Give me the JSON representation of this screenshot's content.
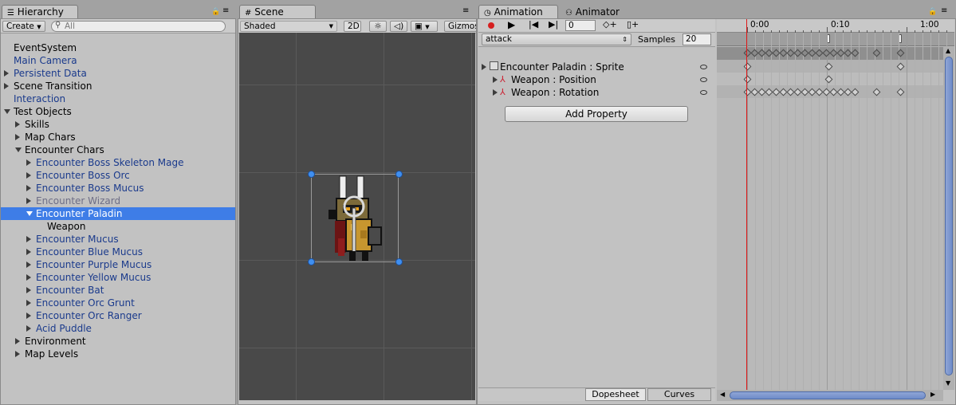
{
  "hierarchy": {
    "tab_label": "Hierarchy",
    "create_label": "Create",
    "search_placeholder": "All",
    "items": [
      {
        "label": "EventSystem",
        "depth": 0,
        "arrow": "none",
        "style": "normal"
      },
      {
        "label": "Main Camera",
        "depth": 0,
        "arrow": "none",
        "style": "blue"
      },
      {
        "label": "Persistent Data",
        "depth": 0,
        "arrow": "right",
        "style": "blue"
      },
      {
        "label": "Scene Transition",
        "depth": 0,
        "arrow": "right",
        "style": "normal"
      },
      {
        "label": "Interaction",
        "depth": 0,
        "arrow": "none",
        "style": "blue"
      },
      {
        "label": "Test Objects",
        "depth": 0,
        "arrow": "down",
        "style": "normal"
      },
      {
        "label": "Skills",
        "depth": 1,
        "arrow": "right",
        "style": "normal"
      },
      {
        "label": "Map Chars",
        "depth": 1,
        "arrow": "right",
        "style": "normal"
      },
      {
        "label": "Encounter Chars",
        "depth": 1,
        "arrow": "down",
        "style": "normal"
      },
      {
        "label": "Encounter Boss Skeleton Mage",
        "depth": 2,
        "arrow": "right",
        "style": "blue"
      },
      {
        "label": "Encounter Boss Orc",
        "depth": 2,
        "arrow": "right",
        "style": "blue"
      },
      {
        "label": "Encounter Boss Mucus",
        "depth": 2,
        "arrow": "right",
        "style": "blue"
      },
      {
        "label": "Encounter Wizard",
        "depth": 2,
        "arrow": "right",
        "style": "gray"
      },
      {
        "label": "Encounter Paladin",
        "depth": 2,
        "arrow": "down",
        "style": "selected"
      },
      {
        "label": "Weapon",
        "depth": 3,
        "arrow": "none",
        "style": "normal"
      },
      {
        "label": "Encounter Mucus",
        "depth": 2,
        "arrow": "right",
        "style": "blue"
      },
      {
        "label": "Encounter Blue Mucus",
        "depth": 2,
        "arrow": "right",
        "style": "blue"
      },
      {
        "label": "Encounter Purple Mucus",
        "depth": 2,
        "arrow": "right",
        "style": "blue"
      },
      {
        "label": "Encounter Yellow Mucus",
        "depth": 2,
        "arrow": "right",
        "style": "blue"
      },
      {
        "label": "Encounter Bat",
        "depth": 2,
        "arrow": "right",
        "style": "blue"
      },
      {
        "label": "Encounter Orc Grunt",
        "depth": 2,
        "arrow": "right",
        "style": "blue"
      },
      {
        "label": "Encounter Orc Ranger",
        "depth": 2,
        "arrow": "right",
        "style": "blue"
      },
      {
        "label": "Acid Puddle",
        "depth": 2,
        "arrow": "right",
        "style": "blue"
      },
      {
        "label": "Environment",
        "depth": 1,
        "arrow": "right",
        "style": "normal"
      },
      {
        "label": "Map Levels",
        "depth": 1,
        "arrow": "right",
        "style": "normal"
      }
    ]
  },
  "scene": {
    "tab_label": "Scene",
    "shading_mode": "Shaded",
    "mode_2d": "2D",
    "gizmos_label": "Gizmos"
  },
  "animation": {
    "tab_label": "Animation",
    "animator_tab_label": "Animator",
    "frame_value": "0",
    "clip_name": "attack",
    "samples_label": "Samples",
    "samples_value": "20",
    "properties": [
      {
        "label": "Encounter Paladin : Sprite",
        "indent": 0
      },
      {
        "label": "Weapon : Position",
        "indent": 1
      },
      {
        "label": "Weapon : Rotation",
        "indent": 1
      }
    ],
    "add_property_label": "Add Property",
    "dopesheet_label": "Dopesheet",
    "curves_label": "Curves",
    "time_labels": [
      "0:00",
      "0:10",
      "1:00"
    ]
  },
  "colors": {
    "selection": "#3e7de7",
    "playhead": "#e01919",
    "record": "#d62020"
  }
}
